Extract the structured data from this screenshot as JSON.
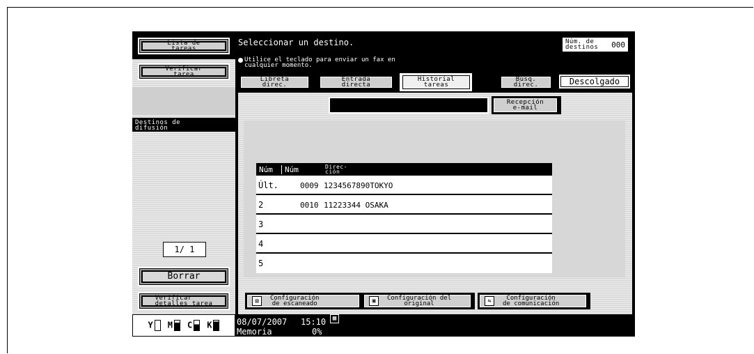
{
  "sidebar": {
    "job_list_label": "Lista de\ntareas",
    "check_job_label": "Verificar\ntarea",
    "broadcast_label": "Destinos de\ndifusión",
    "page_counter": "1/ 1",
    "delete_label": "Borrar",
    "check_job_details_label": "Verificar\ndetalles tarea",
    "toner": {
      "y": "Y",
      "m": "M",
      "c": "C",
      "k": "K"
    }
  },
  "header": {
    "title": "Seleccionar un destino.",
    "message": "Utilice el teclado para enviar un fax en\ncualquier momento.",
    "dest_count_label": "Núm. de\ndestinos",
    "dest_count_value": "000"
  },
  "tabs": [
    {
      "label": "Libreta\ndirec."
    },
    {
      "label": "Entrada\ndirecta"
    },
    {
      "label": "Historial\ntareas"
    },
    {
      "label": "Búsq.\ndirec."
    }
  ],
  "off_hook_label": "Descolgado",
  "search": {
    "value": "",
    "email_reception_label": "Recepción\ne-mail"
  },
  "table": {
    "columns": [
      "Núm",
      "Núm",
      "Direc-\nción"
    ],
    "rows": [
      {
        "idx": "Últ.",
        "num": "0009",
        "addr": "1234567890TOKYO"
      },
      {
        "idx": "2",
        "num": "0010",
        "addr": "11223344 OSAKA"
      },
      {
        "idx": "3",
        "num": "",
        "addr": ""
      },
      {
        "idx": "4",
        "num": "",
        "addr": ""
      },
      {
        "idx": "5",
        "num": "",
        "addr": ""
      }
    ]
  },
  "bottom_buttons": {
    "scan_config": "Configuración\nde escaneado",
    "original_config": "Configuración del\noriginal",
    "comm_config": "Configuración\nde comunicación"
  },
  "status": {
    "date": "08/07/2007",
    "time": "15:10",
    "memory_label": "Memoria",
    "memory_value": "0%"
  }
}
